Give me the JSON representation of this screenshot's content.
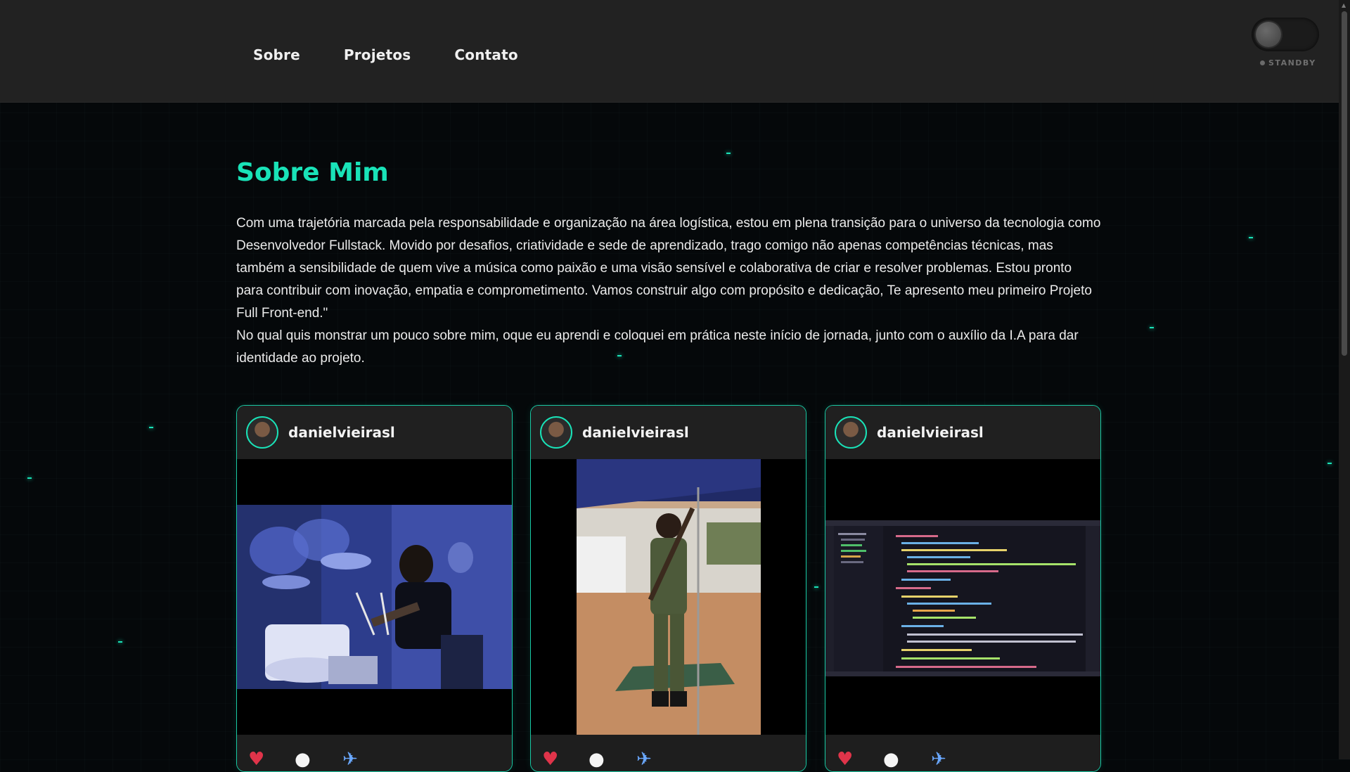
{
  "nav": {
    "items": [
      "Sobre",
      "Projetos",
      "Contato"
    ]
  },
  "status": {
    "label": "STANDBY"
  },
  "section": {
    "title": "Sobre Mim",
    "paragraphs": [
      "Com uma trajetória marcada pela responsabilidade e organização na área logística, estou em plena transição para o universo da tecnologia como Desenvolvedor Fullstack. Movido por desafios, criatividade e sede de aprendizado, trago comigo não apenas competências técnicas, mas também a sensibilidade de quem vive a música como paixão e uma visão sensível e colaborativa de criar e resolver problemas. Estou pronto para contribuir com inovação, empatia e comprometimento. Vamos construir algo com propósito e dedicação, Te apresento meu primeiro Projeto Full Front-end.\"",
      "No qual quis monstrar um pouco sobre mim, oque eu aprendi e coloquei em prática neste início de jornada, junto com o auxílio da I.A para dar identidade ao projeto."
    ]
  },
  "cards": [
    {
      "username": "danielvieirasl",
      "image": "drummer-photo"
    },
    {
      "username": "danielvieirasl",
      "image": "soldier-photo"
    },
    {
      "username": "danielvieirasl",
      "image": "code-editor-screenshot"
    }
  ],
  "colors": {
    "accent": "#19e3b8",
    "topbar": "#222222",
    "background": "#05080a"
  },
  "icons": [
    "heart-icon",
    "comment-icon",
    "share-icon"
  ]
}
